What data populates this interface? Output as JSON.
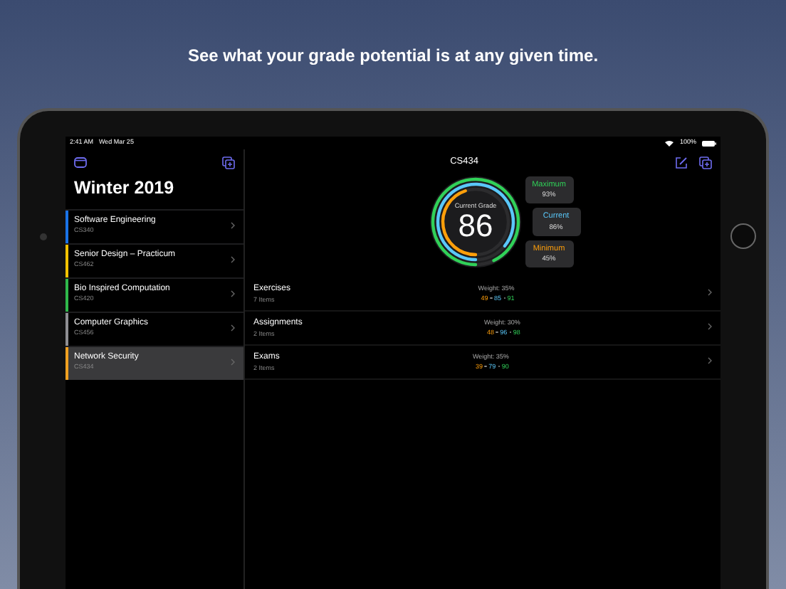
{
  "caption": "See what your grade potential is at any given time.",
  "status_bar": {
    "time": "2:41 AM",
    "date": "Wed Mar 25",
    "battery": "100%"
  },
  "sidebar": {
    "title": "Winter 2019",
    "courses": [
      {
        "name": "Software Engineering",
        "code": "CS340",
        "color": "#1a73e8",
        "selected": false
      },
      {
        "name": "Senior Design – Practicum",
        "code": "CS462",
        "color": "#f2c200",
        "selected": false
      },
      {
        "name": "Bio Inspired Computation",
        "code": "CS420",
        "color": "#2fb84a",
        "selected": false
      },
      {
        "name": "Computer Graphics",
        "code": "CS456",
        "color": "#8e8e93",
        "selected": false
      },
      {
        "name": "Network Security",
        "code": "CS434",
        "color": "#f0a020",
        "selected": true
      }
    ]
  },
  "detail": {
    "title": "CS434",
    "gauge": {
      "label": "Current Grade",
      "value": "86",
      "rings": [
        {
          "name": "Maximum",
          "reading": "93%",
          "color": "#30d158",
          "level": 0.93
        },
        {
          "name": "Current",
          "reading": "86%",
          "color": "#5ac8fa",
          "level": 0.86
        },
        {
          "name": "Minimum",
          "reading": "45%",
          "color": "#ff9f0a",
          "level": 0.45
        }
      ]
    },
    "categories": [
      {
        "name": "Exercises",
        "count": "7 Items",
        "weight": "Weight: 35%",
        "scores": [
          "49",
          "85",
          "91"
        ]
      },
      {
        "name": "Assignments",
        "count": "2 Items",
        "weight": "Weight: 30%",
        "scores": [
          "48",
          "96",
          "98"
        ]
      },
      {
        "name": "Exams",
        "count": "2 Items",
        "weight": "Weight: 35%",
        "scores": [
          "39",
          "79",
          "90"
        ]
      }
    ]
  }
}
